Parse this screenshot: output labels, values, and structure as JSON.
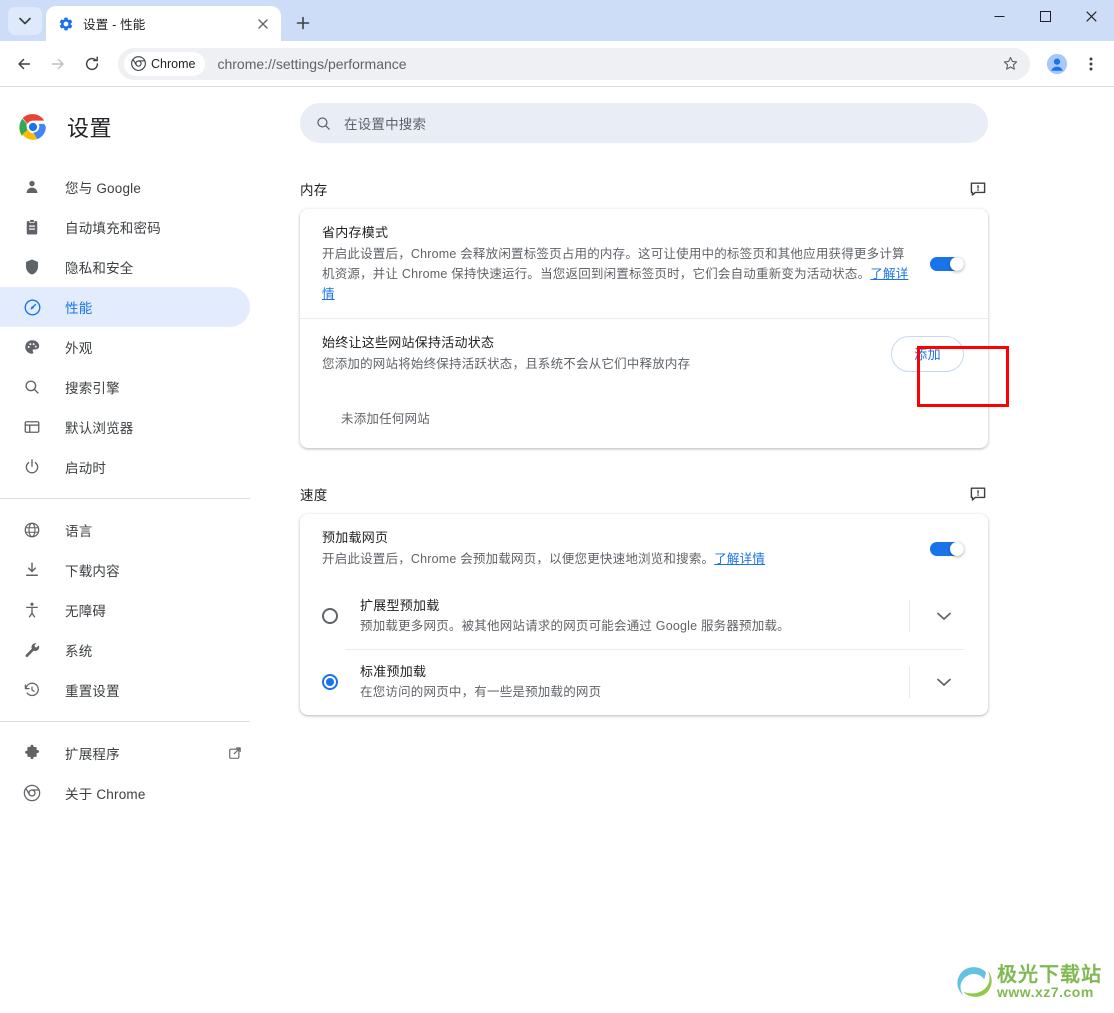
{
  "window": {
    "tab": {
      "title": "设置 - 性能",
      "favicon": "gear-icon",
      "close_label": "×"
    },
    "tab_search_label": "搜索标签页",
    "new_tab_label": "+",
    "controls": {
      "minimize": "—",
      "maximize": "□",
      "close": "×"
    }
  },
  "toolbar": {
    "back": "back-arrow",
    "forward": "forward-arrow",
    "reload": "reload-icon",
    "omnibox_chip": "Chrome",
    "url": "chrome://settings/performance",
    "bookmark": "star-icon",
    "profile": "profile-avatar",
    "menu": "three-dot-menu"
  },
  "sidebar": {
    "title": "设置",
    "items": [
      {
        "label": "您与 Google",
        "icon": "person-icon",
        "active": false
      },
      {
        "label": "自动填充和密码",
        "icon": "clipboard-icon",
        "active": false
      },
      {
        "label": "隐私和安全",
        "icon": "shield-icon",
        "active": false
      },
      {
        "label": "性能",
        "icon": "speedometer-icon",
        "active": true
      },
      {
        "label": "外观",
        "icon": "palette-icon",
        "active": false
      },
      {
        "label": "搜索引擎",
        "icon": "search-icon",
        "active": false
      },
      {
        "label": "默认浏览器",
        "icon": "browser-window-icon",
        "active": false
      },
      {
        "label": "启动时",
        "icon": "power-icon",
        "active": false
      }
    ],
    "items2": [
      {
        "label": "语言",
        "icon": "globe-icon"
      },
      {
        "label": "下载内容",
        "icon": "download-icon"
      },
      {
        "label": "无障碍",
        "icon": "accessibility-icon"
      },
      {
        "label": "系统",
        "icon": "wrench-icon"
      },
      {
        "label": "重置设置",
        "icon": "history-restore-icon"
      }
    ],
    "items3": [
      {
        "label": "扩展程序",
        "icon": "puzzle-icon",
        "external": true
      },
      {
        "label": "关于 Chrome",
        "icon": "chrome-logo-icon",
        "external": false
      }
    ]
  },
  "search": {
    "placeholder": "在设置中搜索",
    "icon": "search-icon"
  },
  "sections": [
    {
      "title": "内存",
      "feedback_icon": "feedback-icon",
      "rows": [
        {
          "type": "toggle",
          "title": "省内存模式",
          "desc_part1": "开启此设置后，Chrome 会释放闲置标签页占用的内存。这可让使用中的标签页和其他应用获得更多计算机资源，并让 Chrome 保持快速运行。当您返回到闲置标签页时，它们会自动重新变为活动状态。",
          "desc_link": "了解详情",
          "toggle_on": true
        },
        {
          "type": "button",
          "title": "始终让这些网站保持活动状态",
          "desc": "您添加的网站将始终保持活跃状态，且系统不会从它们中释放内存",
          "button_label": "添加"
        },
        {
          "type": "empty",
          "text": "未添加任何网站"
        }
      ]
    },
    {
      "title": "速度",
      "feedback_icon": "feedback-icon",
      "rows": [
        {
          "type": "toggle",
          "title": "预加载网页",
          "desc_part1": "开启此设置后，Chrome 会预加载网页，以便您更快速地浏览和搜索。",
          "desc_link": "了解详情",
          "toggle_on": true
        }
      ],
      "radios": [
        {
          "title": "扩展型预加载",
          "desc": "预加载更多网页。被其他网站请求的网页可能会通过 Google 服务器预加载。",
          "checked": false,
          "expand_icon": "chevron-down-icon"
        },
        {
          "title": "标准预加载",
          "desc": "在您访问的网页中，有一些是预加载的网页",
          "checked": true,
          "expand_icon": "chevron-down-icon"
        }
      ]
    }
  ],
  "highlight": {
    "color": "#ff0000",
    "target": "memory-saver-toggle"
  },
  "watermark": {
    "title": "极光下载站",
    "url": "www.xz7.com"
  },
  "colors": {
    "accent": "#1a73e8",
    "tabstrip": "#cdddf8",
    "active_nav_bg": "#e3ecfd",
    "search_bg": "#e9eef6",
    "highlight": "#ff0000",
    "watermark_green": "#7ab648"
  }
}
